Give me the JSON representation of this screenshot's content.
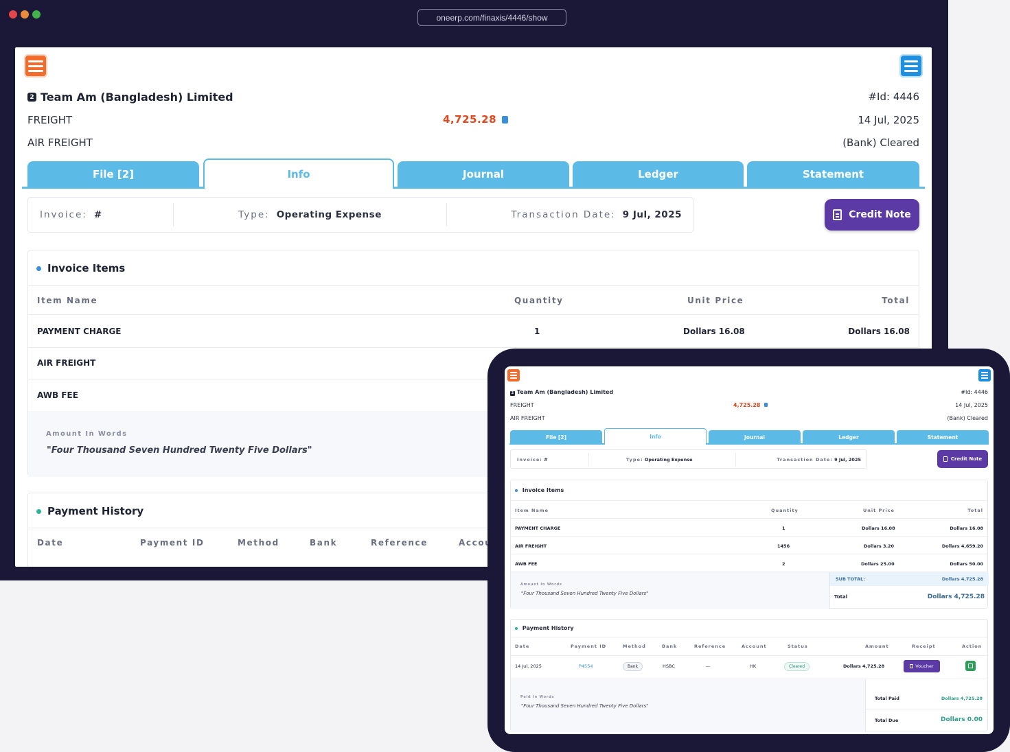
{
  "browser": {
    "url": "oneerp.com/finaxis/4446/show",
    "dot_colors": [
      "#e0464a",
      "#e88b3a",
      "#43b24c"
    ]
  },
  "header": {
    "company": "Team Am (Bangladesh) Limited",
    "company_badge": "2",
    "category": "FREIGHT",
    "subcategory": "AIR FREIGHT",
    "amount": "4,725.28",
    "id_label": "#Id:",
    "id_value": "4446",
    "date": "14 Jul, 2025",
    "status": "(Bank) Cleared"
  },
  "tabs": [
    "File [2]",
    "Info",
    "Journal",
    "Ledger",
    "Statement"
  ],
  "meta": {
    "invoice_label": "Invoice:",
    "invoice_value": "#",
    "type_label": "Type:",
    "type_value": "Operating Expense",
    "txn_label": "Transaction Date:",
    "txn_value": "9 Jul, 2025"
  },
  "credit_note_label": "Credit Note",
  "invoice_items": {
    "title": "Invoice Items",
    "columns": [
      "Item Name",
      "Quantity",
      "Unit Price",
      "Total"
    ],
    "rows": [
      {
        "name": "PAYMENT CHARGE",
        "qty": "1",
        "unit": "Dollars 16.08",
        "total": "Dollars 16.08"
      },
      {
        "name": "AIR FREIGHT",
        "qty": "1456",
        "unit": "Dollars 3.20",
        "total": "Dollars 4,659.20"
      },
      {
        "name": "AWB FEE",
        "qty": "2",
        "unit": "Dollars 25.00",
        "total": "Dollars 50.00"
      }
    ],
    "words_label": "Amount In Words",
    "words": "\"Four Thousand Seven Hundred Twenty Five Dollars\"",
    "subtotal_label": "SUB TOTAL:",
    "subtotal": "Dollars 4,725.28",
    "total_label": "Total",
    "total": "Dollars 4,725.28"
  },
  "payment_history": {
    "title": "Payment History",
    "columns": [
      "Date",
      "Payment ID",
      "Method",
      "Bank",
      "Reference",
      "Account",
      "Status",
      "Amount",
      "Receipt",
      "Action"
    ],
    "desk_columns": [
      "Date",
      "Payment ID",
      "Method",
      "Bank",
      "Reference",
      "Accou"
    ],
    "row": {
      "date": "14 Jul, 2025",
      "payment_id": "P4554",
      "method": "Bank",
      "bank": "HSBC",
      "reference": "—",
      "account": "HK",
      "status": "Cleared",
      "amount": "Dollars 4,725.28",
      "receipt": "Voucher"
    },
    "paid_words_label": "Paid In Words",
    "paid_words": "\"Four Thousand Seven Hundred Twenty Five Dollars\"",
    "total_paid_label": "Total Paid",
    "total_paid": "Dollars 4,725.28",
    "total_due_label": "Total Due",
    "total_due": "Dollars 0.00"
  }
}
